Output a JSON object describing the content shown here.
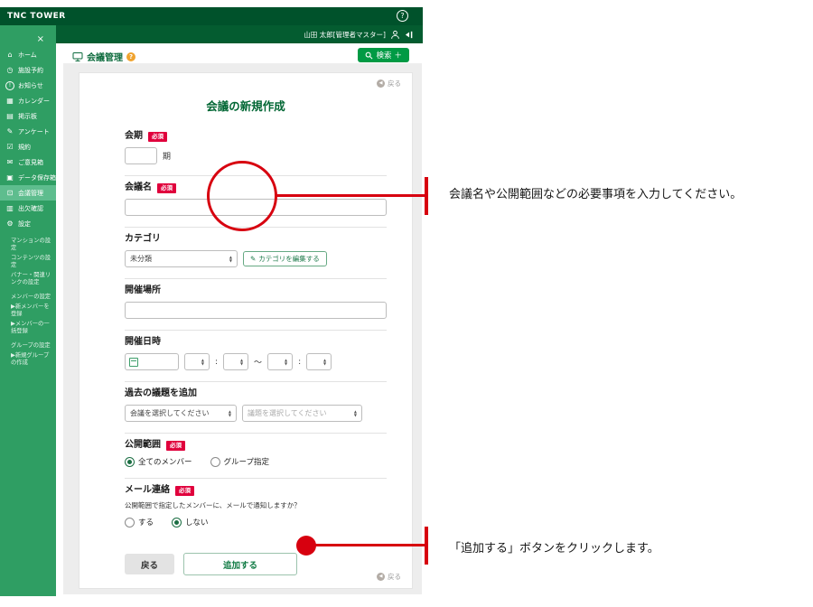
{
  "header": {
    "brand": "TNC TOWER",
    "user_name": "山田 太郎[管理者マスター]"
  },
  "icons": {
    "help": "?",
    "close": "×",
    "back_arrow": "◀",
    "pencil": "✎",
    "plus": "＋",
    "spinner_up": "▲",
    "spinner_down": "▼",
    "question_badge": "?",
    "tilde": "〜",
    "colon": ":"
  },
  "sidebar": {
    "items": [
      {
        "label": "ホーム",
        "glyph": "⌂"
      },
      {
        "label": "施設予約",
        "glyph": "◷"
      },
      {
        "label": "お知らせ",
        "glyph": "!"
      },
      {
        "label": "カレンダー",
        "glyph": "▦"
      },
      {
        "label": "掲示板",
        "glyph": "▤"
      },
      {
        "label": "アンケート",
        "glyph": "✎"
      },
      {
        "label": "規約",
        "glyph": "☑"
      },
      {
        "label": "ご意見箱",
        "glyph": "✉"
      },
      {
        "label": "データ保存箱",
        "glyph": "▣"
      },
      {
        "label": "会議管理",
        "glyph": "⊡"
      },
      {
        "label": "出欠確認",
        "glyph": "▥"
      },
      {
        "label": "設定",
        "glyph": "⚙"
      }
    ],
    "subitems": [
      {
        "label": "マンションの設定"
      },
      {
        "label": "コンテンツの設定"
      },
      {
        "label": "バナー・関連リンクの設定"
      },
      {
        "label": "メンバーの設定"
      },
      {
        "label": "▶新メンバーを登録"
      },
      {
        "label": "▶メンバーの一括登録"
      },
      {
        "label": "グループの設定"
      },
      {
        "label": "▶新規グループの作成"
      }
    ]
  },
  "toolbar": {
    "module_title": "会議管理",
    "search_label": "検索"
  },
  "page": {
    "back_link": "戻る",
    "title": "会議の新規作成",
    "required_badge": "必須"
  },
  "form": {
    "kaiki": {
      "label": "会期",
      "value": "",
      "suffix": "期"
    },
    "meeting_name": {
      "label": "会議名",
      "value": ""
    },
    "category": {
      "label": "カテゴリ",
      "selected": "未分類",
      "edit_button": "カテゴリを編集する"
    },
    "venue": {
      "label": "開催場所",
      "value": ""
    },
    "datetime": {
      "label": "開催日時"
    },
    "past_agenda": {
      "label": "過去の議題を追加",
      "meeting_placeholder": "会議を選択してください",
      "agenda_placeholder": "議題を選択してください"
    },
    "scope": {
      "label": "公開範囲",
      "option_all": "全てのメンバー",
      "option_group": "グループ指定"
    },
    "mail": {
      "label": "メール連絡",
      "description": "公開範囲で指定したメンバーに、メールで通知しますか？",
      "option_yes": "する",
      "option_no": "しない"
    },
    "back_button": "戻る",
    "submit_button": "追加する"
  },
  "annotations": [
    {
      "text": "会議名や公開範囲などの必要事項を入力してください。"
    },
    {
      "text": "「追加する」ボタンをクリックします。"
    }
  ],
  "colors": {
    "header_green": "#00522b",
    "sidebar_green": "#2f9e63",
    "active_item_green": "#5ebd8e",
    "accent_green": "#009a44",
    "title_green": "#006633",
    "required_red": "#e0003c",
    "annotation_red": "#d7000f"
  }
}
